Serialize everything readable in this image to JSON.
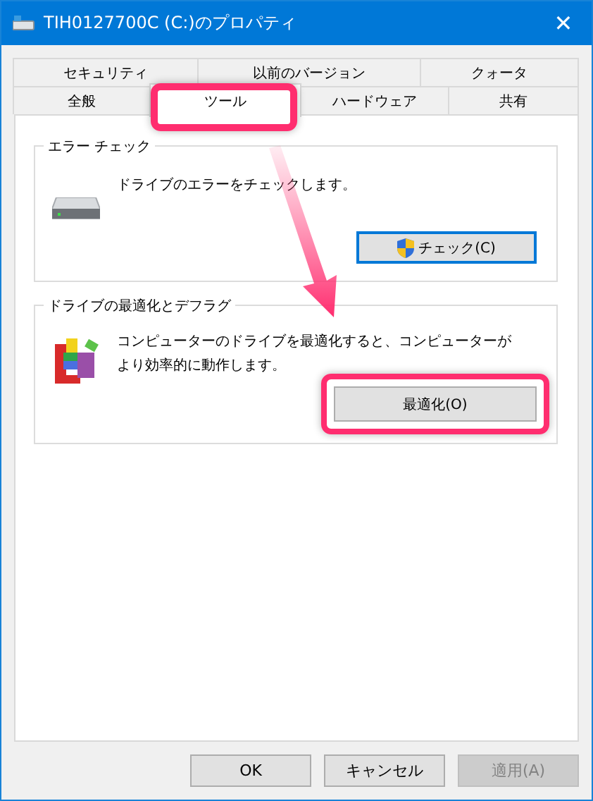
{
  "window": {
    "title": "TIH0127700C (C:)のプロパティ",
    "close": "✕"
  },
  "tabs": {
    "back_row": [
      {
        "label": "セキュリティ",
        "selected": false
      },
      {
        "label": "以前のバージョン",
        "selected": false
      },
      {
        "label": "クォータ",
        "selected": false
      }
    ],
    "front_row": [
      {
        "label": "全般",
        "selected": false
      },
      {
        "label": "ツール",
        "selected": true
      },
      {
        "label": "ハードウェア",
        "selected": false
      },
      {
        "label": "共有",
        "selected": false
      }
    ]
  },
  "groups": [
    {
      "kind": "check",
      "title": "エラー チェック",
      "text": "ドライブのエラーをチェックします。",
      "button": "チェック(C)"
    },
    {
      "kind": "optimize",
      "title": "ドライブの最適化とデフラグ",
      "text": "コンピューターのドライブを最適化すると、コンピューターがより効率的に動作します。",
      "button": "最適化(O)"
    }
  ],
  "buttons": [
    {
      "label": "OK",
      "disabled": false
    },
    {
      "label": "キャンセル",
      "disabled": false
    },
    {
      "label": "適用(A)",
      "disabled": true
    }
  ]
}
